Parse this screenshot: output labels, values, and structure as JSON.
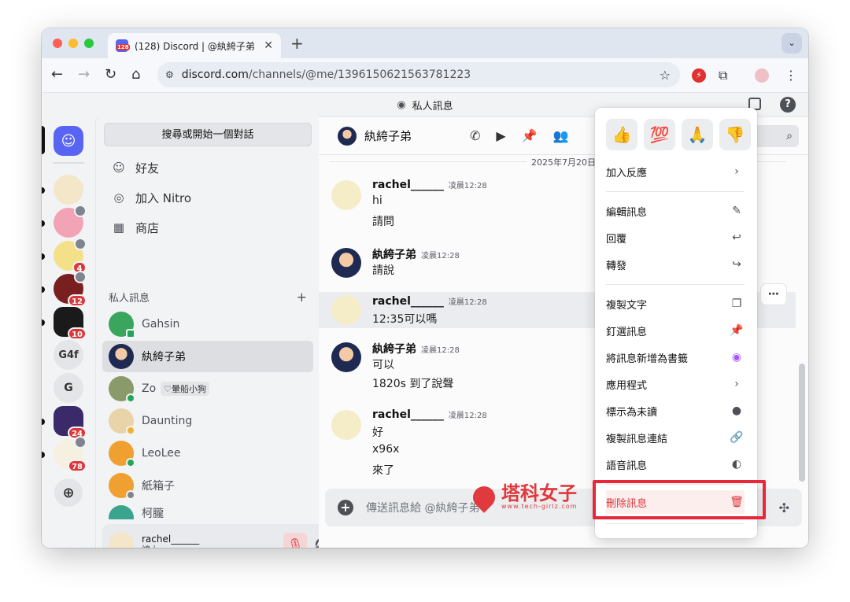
{
  "browser": {
    "tab_title": "(128) Discord | @紈絝子弟",
    "tab_badge": "128",
    "close_glyph": "✕",
    "new_tab_glyph": "+",
    "tab_menu_glyph": "⌄",
    "url_domain": "discord.com",
    "url_path": "/channels/@me/1396150621563781223"
  },
  "app": {
    "title": "私人訊息",
    "search_label": "搜尋或開始一個對話",
    "nav": [
      {
        "label": "好友",
        "icon": "friends-icon"
      },
      {
        "label": "加入 Nitro",
        "icon": "nitro-icon"
      },
      {
        "label": "商店",
        "icon": "shop-icon"
      }
    ],
    "dm_header": "私人訊息",
    "dm_add": "+",
    "dms": [
      {
        "name": "Gahsin",
        "tag": ""
      },
      {
        "name": "紈絝子弟",
        "tag": ""
      },
      {
        "name": "Zo",
        "tag": "♡暈船小狗"
      },
      {
        "name": "Daunting",
        "tag": ""
      },
      {
        "name": "LeoLee",
        "tag": ""
      },
      {
        "name": "紙箱子",
        "tag": ""
      },
      {
        "name": "柯朧",
        "tag": ""
      }
    ],
    "servers": [
      {
        "label": "",
        "badge": ""
      },
      {
        "label": "",
        "badge": ""
      },
      {
        "label": "",
        "badge": "4"
      },
      {
        "label": "",
        "badge": "12"
      },
      {
        "label": "",
        "badge": "10"
      },
      {
        "label": "G4f",
        "badge": ""
      },
      {
        "label": "G",
        "badge": ""
      },
      {
        "label": "",
        "badge": "24"
      },
      {
        "label": "",
        "badge": "78"
      }
    ],
    "user": {
      "name": "rachel______",
      "status": "線上"
    }
  },
  "chat": {
    "title": "紈絝子弟",
    "date": "2025年7月20日",
    "messages": [
      {
        "author": "rachel______",
        "time": "凌晨12:28",
        "lines": [
          "hi",
          "請問"
        ]
      },
      {
        "author": "紈絝子弟",
        "time": "凌晨12:28",
        "lines": [
          "請說"
        ]
      },
      {
        "author": "rachel______",
        "time": "凌晨12:28",
        "lines": [
          "12:35可以嗎"
        ]
      },
      {
        "author": "紈絝子弟",
        "time": "凌晨12:28",
        "lines": [
          "可以",
          "1820s 到了說聲"
        ]
      },
      {
        "author": "rachel______",
        "time": "凌晨12:28",
        "lines": [
          "好",
          "x96x",
          "來了"
        ]
      }
    ],
    "composer_placeholder": "傳送訊息給 @紈絝子弟"
  },
  "watermark": {
    "title": "塔科女子",
    "sub": "www.tech-girlz.com"
  },
  "context_menu": {
    "reactions": [
      "👍",
      "💯",
      "🙏",
      "👎"
    ],
    "add_reaction": "加入反應",
    "items": [
      {
        "label": "編輯訊息",
        "icon": "✎"
      },
      {
        "label": "回覆",
        "icon": "↩"
      },
      {
        "label": "轉發",
        "icon": "↪"
      },
      {
        "label": "複製文字",
        "icon": "❐"
      },
      {
        "label": "釘選訊息",
        "icon": "📌"
      },
      {
        "label": "將訊息新增為書籤",
        "icon": "◉"
      },
      {
        "label": "應用程式",
        "icon": "›"
      },
      {
        "label": "標示為未讀",
        "icon": "●"
      },
      {
        "label": "複製訊息連結",
        "icon": "🔗"
      },
      {
        "label": "語音訊息",
        "icon": "◐"
      }
    ],
    "delete_label": "刪除訊息",
    "delete_icon": "🗑"
  }
}
